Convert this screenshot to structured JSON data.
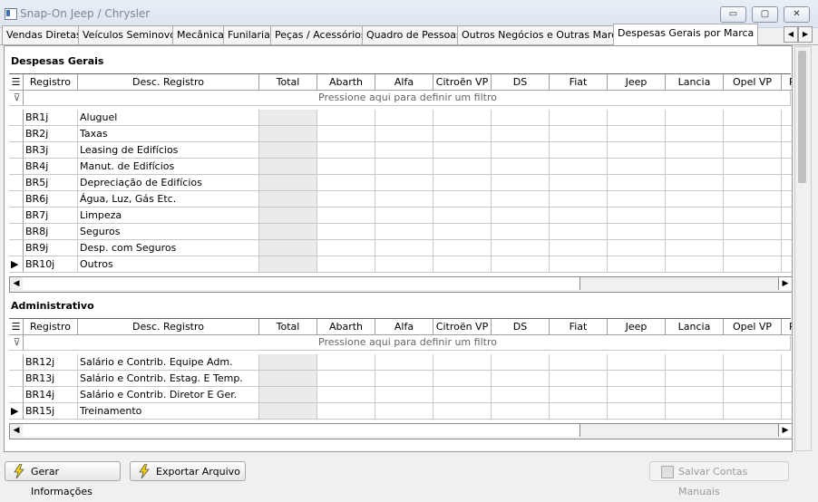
{
  "window": {
    "title": "Snap-On Jeep / Chrysler",
    "controls": {
      "minimize": "▭",
      "maximize": "▢",
      "close": "✕"
    }
  },
  "tabs": [
    {
      "label": "Vendas Diretas"
    },
    {
      "label": "Veículos Seminovos"
    },
    {
      "label": "Mecânica"
    },
    {
      "label": "Funilaria"
    },
    {
      "label": "Peças / Acessórios"
    },
    {
      "label": "Quadro de Pessoas"
    },
    {
      "label": "Outros Negócios e Outras Marcas"
    },
    {
      "label": "Despesas Gerais por Marca"
    }
  ],
  "active_tab": "Despesas Gerais por Marca",
  "columns": [
    "Registro",
    "Desc. Registro",
    "Total",
    "Abarth",
    "Alfa",
    "Citroën VP",
    "DS",
    "Fiat",
    "Jeep",
    "Lancia",
    "Opel VP",
    "Pe"
  ],
  "filter_text": "Pressione aqui para definir um filtro",
  "sections": [
    {
      "title": "Despesas Gerais",
      "rows": [
        {
          "registro": "BR1j",
          "desc": "Aluguel"
        },
        {
          "registro": "BR2j",
          "desc": "Taxas"
        },
        {
          "registro": "BR3j",
          "desc": "Leasing de Edifícios"
        },
        {
          "registro": "BR4j",
          "desc": "Manut. de Edifícios"
        },
        {
          "registro": "BR5j",
          "desc": "Depreciação de Edifícios"
        },
        {
          "registro": "BR6j",
          "desc": "Água, Luz, Gás Etc."
        },
        {
          "registro": "BR7j",
          "desc": "Limpeza"
        },
        {
          "registro": "BR8j",
          "desc": "Seguros"
        },
        {
          "registro": "BR9j",
          "desc": "Desp. com Seguros"
        },
        {
          "registro": "BR10j",
          "desc": "Outros"
        }
      ]
    },
    {
      "title": "Administrativo",
      "rows": [
        {
          "registro": "BR12j",
          "desc": "Salário e Contrib. Equipe Adm."
        },
        {
          "registro": "BR13j",
          "desc": "Salário e Contrib. Estag. E Temp."
        },
        {
          "registro": "BR14j",
          "desc": "Salário e Contrib. Diretor E Ger."
        },
        {
          "registro": "BR15j",
          "desc": "Treinamento"
        }
      ]
    }
  ],
  "footer": {
    "gerar_label": "Gerar Informações",
    "exportar_label": "Exportar Arquivo",
    "salvar_label": "Salvar Contas Manuais"
  }
}
